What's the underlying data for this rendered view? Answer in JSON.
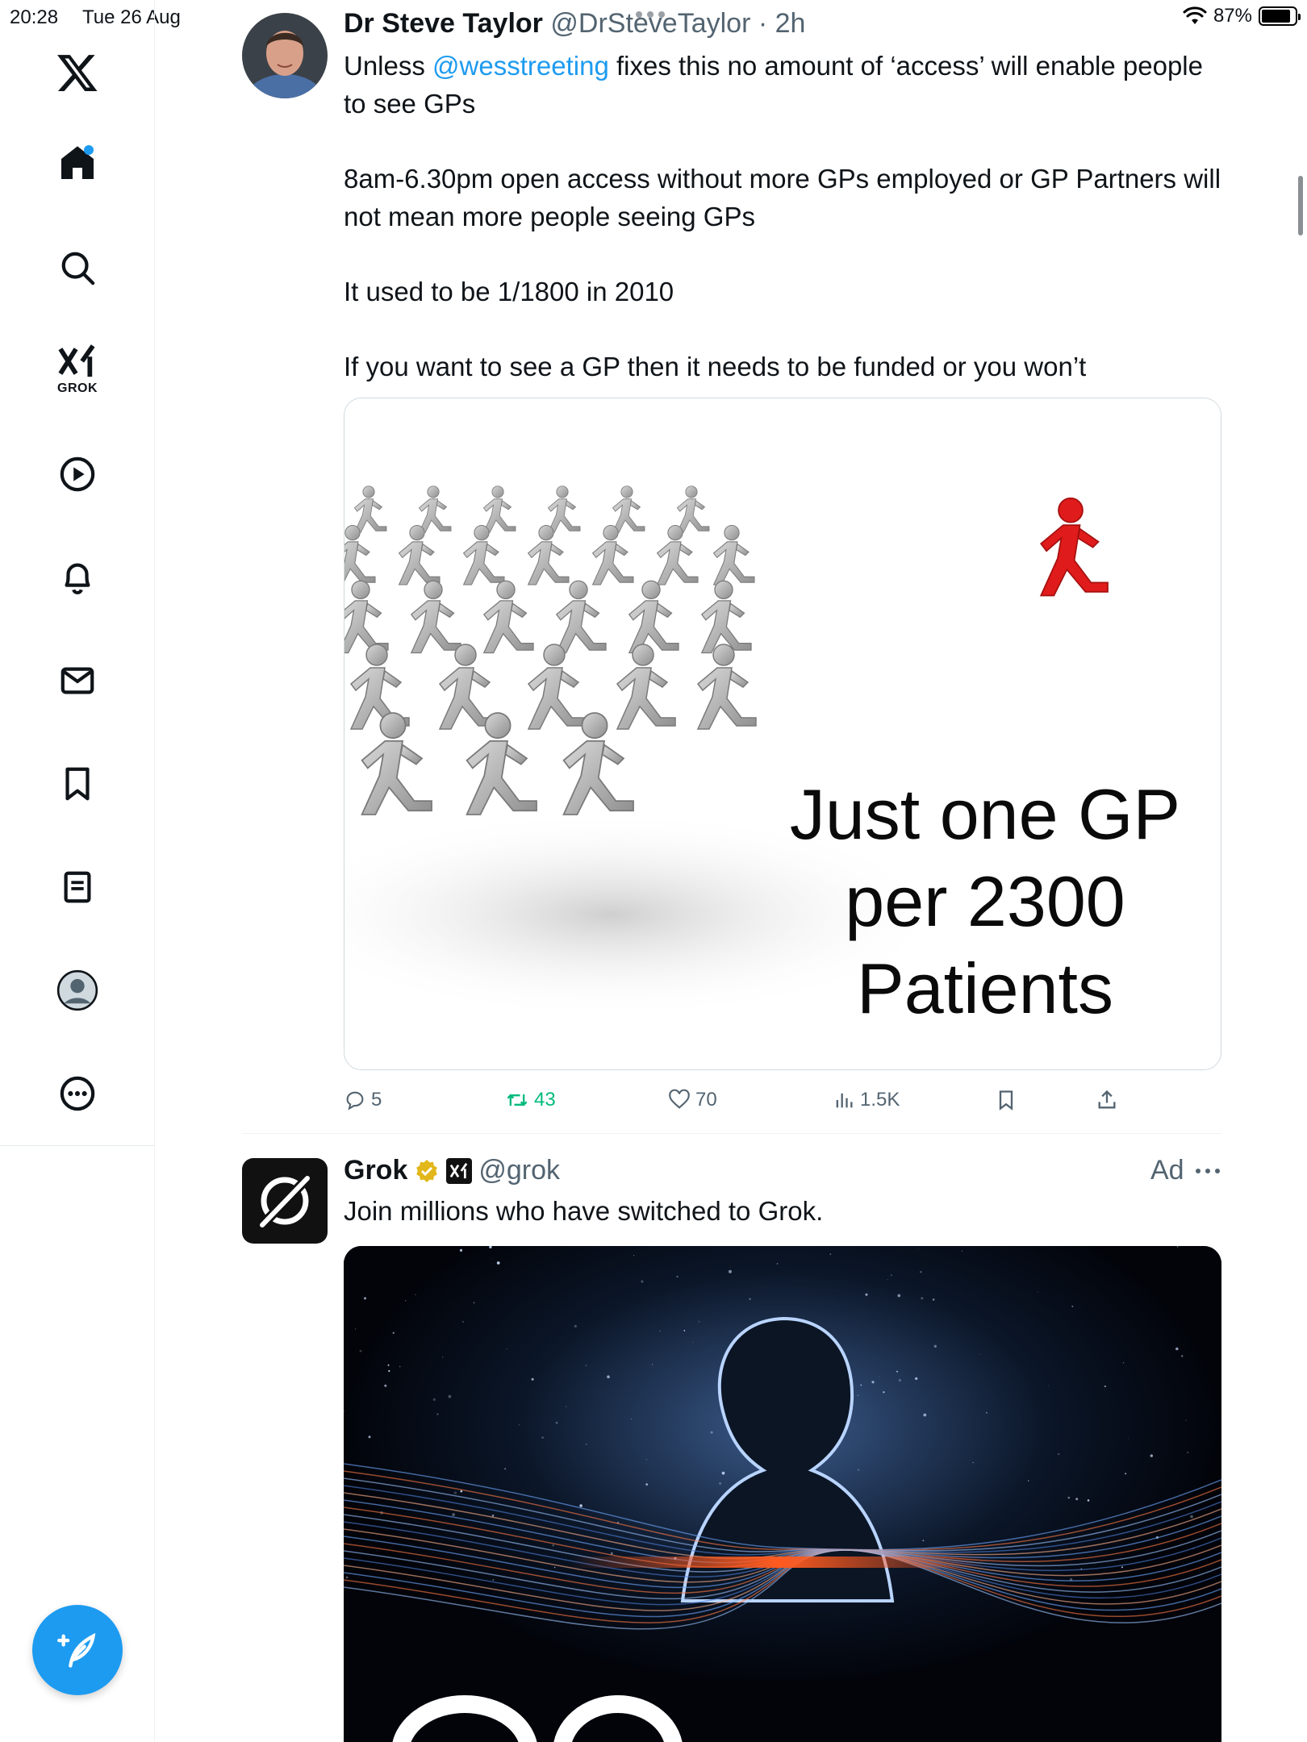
{
  "status_bar": {
    "time": "20:28",
    "date": "Tue 26 Aug",
    "battery": "87%",
    "battery_level": 0.87
  },
  "sidebar": {
    "logo": "x-logo-icon",
    "items": [
      {
        "id": "home",
        "icon": "home-icon",
        "has_notification_dot": true
      },
      {
        "id": "explore",
        "icon": "search-icon"
      },
      {
        "id": "grok",
        "icon": "grok-icon",
        "label": "GROK"
      },
      {
        "id": "videos",
        "icon": "play-icon"
      },
      {
        "id": "notifications",
        "icon": "bell-icon"
      },
      {
        "id": "messages",
        "icon": "mail-icon"
      },
      {
        "id": "bookmarks",
        "icon": "bookmark-icon"
      },
      {
        "id": "articles",
        "icon": "document-icon"
      },
      {
        "id": "profile",
        "icon": "avatar-icon"
      },
      {
        "id": "more",
        "icon": "more-circle-icon"
      }
    ],
    "compose_icon": "compose-icon"
  },
  "tweet1": {
    "author_name": "Dr Steve Taylor",
    "handle": "@DrSteveTaylor",
    "time": "· 2h",
    "body_line1_before": "Unless ",
    "mention": "@wesstreeting",
    "body_line1_after": " fixes this no amount of ‘access’ will enable people to see GPs",
    "para2": "8am-6.30pm open access without more GPs employed or GP Partners will not mean more people seeing GPs",
    "para3": "It used to be 1/1800 in 2010",
    "para4": "If you want to see a GP then it needs to be funded or you won’t",
    "image_text_line1": "Just one GP",
    "image_text_line2": "per 2300",
    "image_text_line3": "Patients",
    "actions": {
      "replies": "5",
      "retweets": "43",
      "likes": "70",
      "views": "1.5K"
    }
  },
  "tweet2": {
    "author_name": "Grok",
    "handle": "@grok",
    "ad_label": "Ad",
    "body": "Join millions who have switched to Grok.",
    "colors": {
      "verified": "#e2b719",
      "accent": "#ff5a1f"
    }
  },
  "colors": {
    "link": "#1d9bf0",
    "retweet": "#00ba7c",
    "muted": "#536471"
  }
}
